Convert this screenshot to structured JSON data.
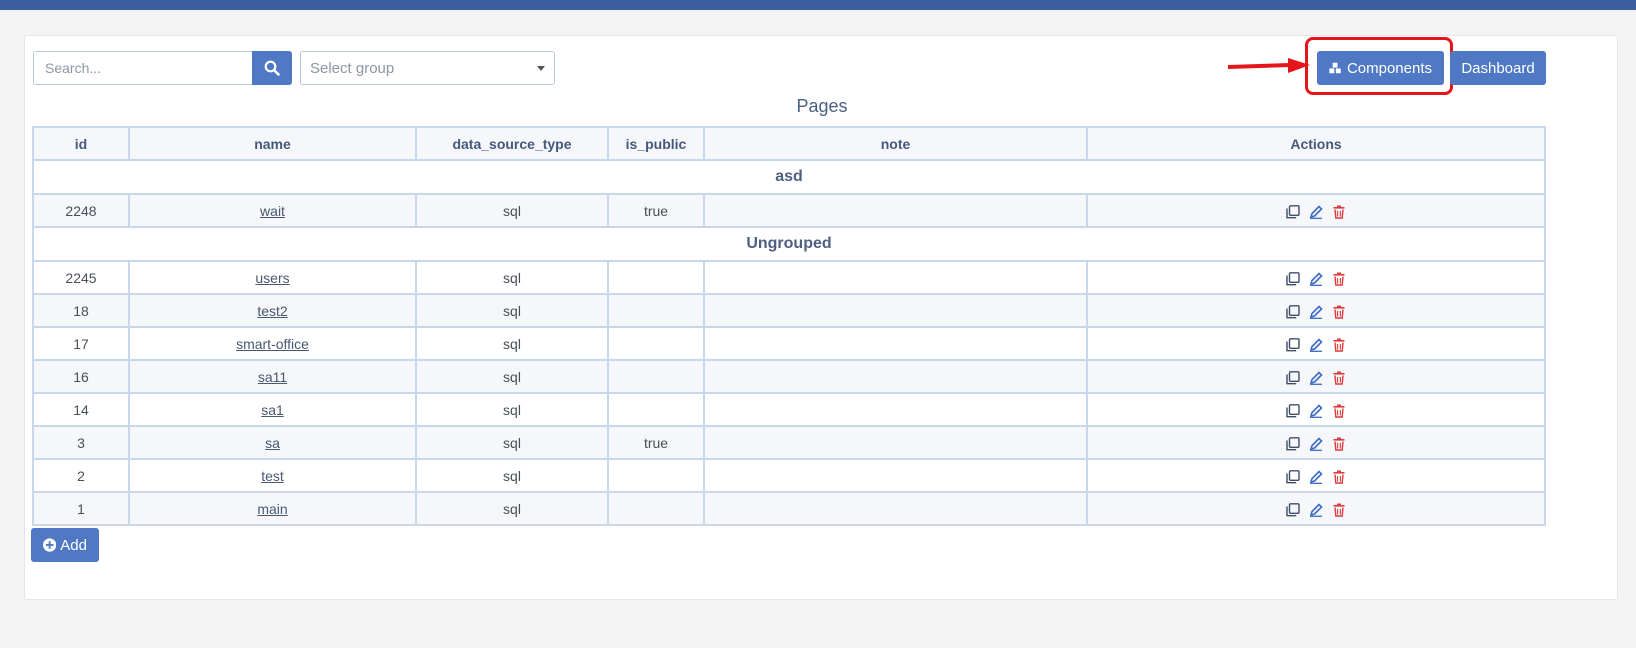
{
  "search": {
    "placeholder": "Search..."
  },
  "group_select": {
    "placeholder": "Select group"
  },
  "toolbar": {
    "components_label": "Components",
    "dashboard_label": "Dashboard"
  },
  "page_title": "Pages",
  "table": {
    "columns": [
      "id",
      "name",
      "data_source_type",
      "is_public",
      "note",
      "Actions"
    ],
    "groups": [
      {
        "name": "asd",
        "rows": [
          {
            "id": "2248",
            "name": "wait",
            "data_source_type": "sql",
            "is_public": "true",
            "note": ""
          }
        ]
      },
      {
        "name": "Ungrouped",
        "rows": [
          {
            "id": "2245",
            "name": "users",
            "data_source_type": "sql",
            "is_public": "",
            "note": ""
          },
          {
            "id": "18",
            "name": "test2",
            "data_source_type": "sql",
            "is_public": "",
            "note": ""
          },
          {
            "id": "17",
            "name": "smart-office",
            "data_source_type": "sql",
            "is_public": "",
            "note": ""
          },
          {
            "id": "16",
            "name": "sa11",
            "data_source_type": "sql",
            "is_public": "",
            "note": ""
          },
          {
            "id": "14",
            "name": "sa1",
            "data_source_type": "sql",
            "is_public": "",
            "note": ""
          },
          {
            "id": "3",
            "name": "sa",
            "data_source_type": "sql",
            "is_public": "true",
            "note": ""
          },
          {
            "id": "2",
            "name": "test",
            "data_source_type": "sql",
            "is_public": "",
            "note": ""
          },
          {
            "id": "1",
            "name": "main",
            "data_source_type": "sql",
            "is_public": "",
            "note": ""
          }
        ]
      }
    ],
    "row_action_icons": [
      "copy-icon",
      "edit-icon",
      "delete-icon"
    ]
  },
  "add_button": {
    "label": "Add"
  },
  "colors": {
    "primary": "#4f79c4",
    "topbar": "#3a5f9c",
    "danger": "#e03a3a",
    "annotation": "#e4161a"
  }
}
